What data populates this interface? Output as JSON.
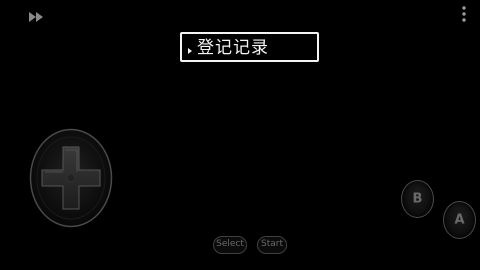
{
  "toolbar": {
    "fast_forward_icon": "fast-forward-icon",
    "menu_icon": "more-vertical-icon"
  },
  "dialog": {
    "text": "登记记录"
  },
  "controls": {
    "dpad_icon": "dpad-icon",
    "b_label": "B",
    "a_label": "A",
    "select_label": "Select",
    "start_label": "Start"
  },
  "colors": {
    "background": "#000000",
    "dialog_text": "#f4f4f4",
    "control_outline": "#4a4a4a",
    "control_label": "#6a6a6a"
  }
}
